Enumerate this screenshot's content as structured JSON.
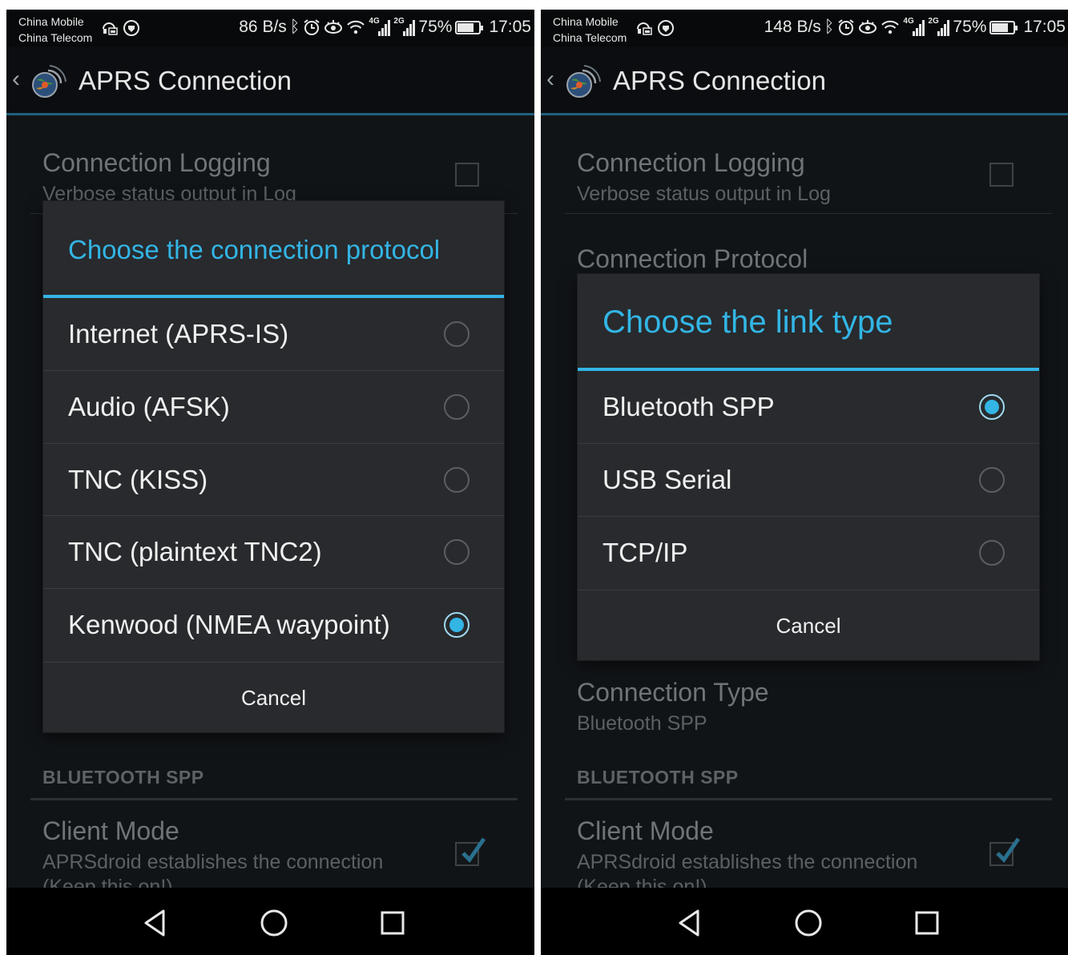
{
  "status_bar": {
    "carrier_1": "China Mobile",
    "carrier_2": "China Telecom",
    "net_speed_left": "86 B/s",
    "net_speed_right": "148 B/s",
    "network_1": "4G",
    "network_2": "2G",
    "battery": "75%",
    "battery_level": 0.75,
    "time": "17:05",
    "icons": [
      "notification-lock-icon",
      "vpn-icon",
      "bluetooth-icon",
      "alarm-icon",
      "eye-comfort-icon",
      "wifi-icon",
      "signal-icon",
      "battery-icon"
    ]
  },
  "action_bar": {
    "title": "APRS Connection",
    "icons": [
      "back-chevron-icon",
      "aprsdroid-globe-icon"
    ]
  },
  "preferences": {
    "connection_logging": {
      "title": "Connection Logging",
      "summary": "Verbose status output in Log",
      "checked": false
    },
    "connection_protocol": {
      "title": "Connection Protocol"
    },
    "connection_type": {
      "title": "Connection Type",
      "summary": "Bluetooth SPP"
    },
    "category": "BLUETOOTH SPP",
    "client_mode": {
      "title": "Client Mode",
      "summary_line_1": "APRSdroid establishes the connection",
      "summary_line_2": "(Keep this on!)",
      "checked": true
    }
  },
  "protocol_dialog": {
    "title": "Choose the connection protocol",
    "options": [
      {
        "label": "Internet (APRS-IS)",
        "selected": false
      },
      {
        "label": "Audio (AFSK)",
        "selected": false
      },
      {
        "label": "TNC (KISS)",
        "selected": false
      },
      {
        "label": "TNC (plaintext TNC2)",
        "selected": false
      },
      {
        "label": "Kenwood (NMEA waypoint)",
        "selected": true
      }
    ],
    "cancel_label": "Cancel"
  },
  "link_dialog": {
    "title": "Choose the link type",
    "options": [
      {
        "label": "Bluetooth SPP",
        "selected": true
      },
      {
        "label": "USB Serial",
        "selected": false
      },
      {
        "label": "TCP/IP",
        "selected": false
      }
    ],
    "cancel_label": "Cancel"
  },
  "nav_bar": {
    "icons": [
      "back-triangle-icon",
      "home-circle-icon",
      "recents-square-icon"
    ]
  },
  "colors": {
    "accent": "#33b5e5",
    "dialog_bg": "#282a2d",
    "screen_bg": "#111417",
    "dim_text": "#707477"
  }
}
